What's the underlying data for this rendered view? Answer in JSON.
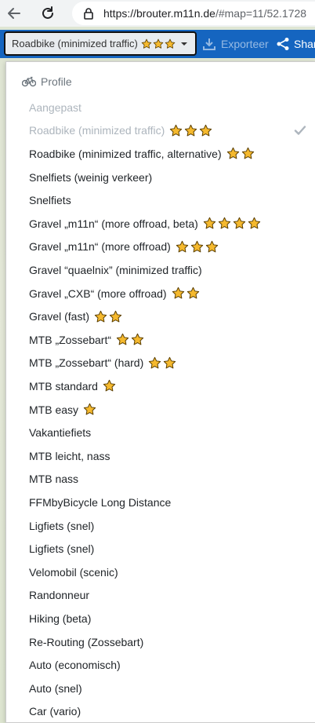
{
  "browser": {
    "url_host": "https://brouter.m11n.de",
    "url_rest": "/#map=11/52.1728"
  },
  "toolbar": {
    "selected_profile": "Roadbike (minimized traffic)",
    "selected_stars": 3,
    "export_label": "Exporteer",
    "share_label": "Share"
  },
  "menu": {
    "header": "Profile",
    "items": [
      {
        "label": "Aangepast",
        "stars": 0,
        "muted": true
      },
      {
        "label": "Roadbike (minimized traffic)",
        "stars": 3,
        "muted": true,
        "checked": true
      },
      {
        "label": "Roadbike (minimized traffic, alternative)",
        "stars": 2
      },
      {
        "label": "Snelfiets (weinig verkeer)",
        "stars": 0
      },
      {
        "label": "Snelfiets",
        "stars": 0
      },
      {
        "label": "Gravel „m11n“ (more offroad, beta)",
        "stars": 4
      },
      {
        "label": "Gravel „m11n“ (more offroad)",
        "stars": 3
      },
      {
        "label": "Gravel “quaelnix” (minimized traffic)",
        "stars": 0
      },
      {
        "label": "Gravel „CXB“ (more offroad)",
        "stars": 2
      },
      {
        "label": "Gravel (fast)",
        "stars": 2
      },
      {
        "label": "MTB „Zossebart“",
        "stars": 2
      },
      {
        "label": "MTB „Zossebart“ (hard)",
        "stars": 2
      },
      {
        "label": "MTB standard",
        "stars": 1
      },
      {
        "label": "MTB easy",
        "stars": 1
      },
      {
        "label": "Vakantiefiets",
        "stars": 0
      },
      {
        "label": "MTB leicht, nass",
        "stars": 0
      },
      {
        "label": "MTB nass",
        "stars": 0
      },
      {
        "label": "FFMbyBicycle Long Distance",
        "stars": 0
      },
      {
        "label": "Ligfiets (snel)",
        "stars": 0
      },
      {
        "label": "Ligfiets (snel)",
        "stars": 0
      },
      {
        "label": "Velomobil (scenic)",
        "stars": 0
      },
      {
        "label": "Randonneur",
        "stars": 0
      },
      {
        "label": "Hiking (beta)",
        "stars": 0
      },
      {
        "label": "Re-Routing (Zossebart)",
        "stars": 0
      },
      {
        "label": "Auto (economisch)",
        "stars": 0
      },
      {
        "label": "Auto (snel)",
        "stars": 0
      },
      {
        "label": "Car (vario)",
        "stars": 0
      }
    ]
  },
  "colors": {
    "accent": "#1565c0",
    "star_fill": "#f5b92e",
    "star_stroke": "#5a3e00"
  }
}
